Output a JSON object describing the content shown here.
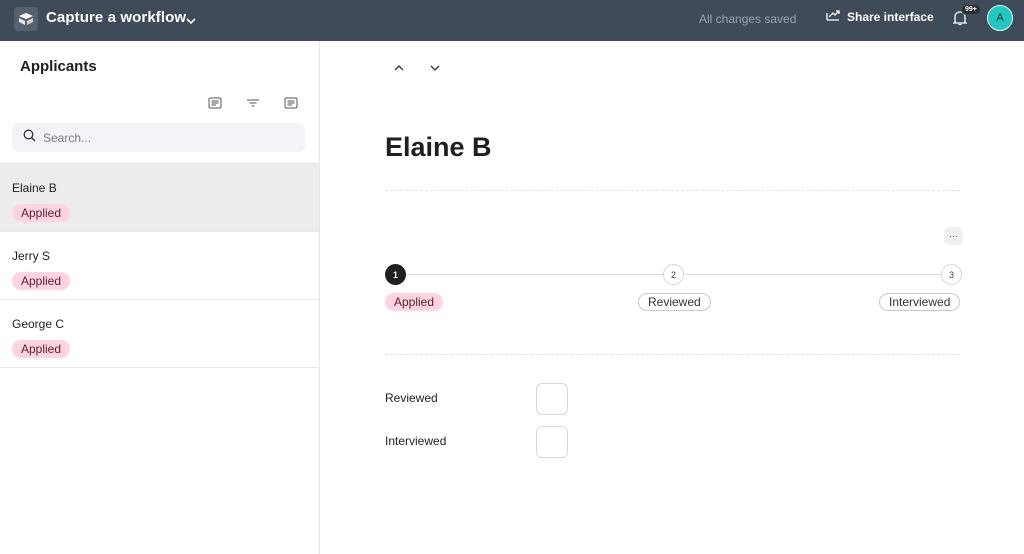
{
  "header": {
    "app_title": "Capture a workflow",
    "save_status": "All changes saved",
    "share_label": "Share interface",
    "notification_count": "99+",
    "avatar_initial": "A"
  },
  "sidebar": {
    "title": "Applicants",
    "search_placeholder": "Search...",
    "records": [
      {
        "name": "Elaine B",
        "status": "Applied",
        "selected": true
      },
      {
        "name": "Jerry S",
        "status": "Applied",
        "selected": false
      },
      {
        "name": "George C",
        "status": "Applied",
        "selected": false
      }
    ]
  },
  "record": {
    "name": "Elaine B",
    "more_label": "···",
    "steps": [
      {
        "number": "1",
        "label": "Applied",
        "active": true
      },
      {
        "number": "2",
        "label": "Reviewed",
        "active": false
      },
      {
        "number": "3",
        "label": "Interviewed",
        "active": false
      }
    ],
    "fields": [
      {
        "label": "Reviewed",
        "checked": false
      },
      {
        "label": "Interviewed",
        "checked": false
      }
    ]
  },
  "colors": {
    "topbar": "#3f4b59",
    "applied_pill": "#ffd4e0",
    "avatar": "#20c9c0",
    "selected_row": "#ececec"
  }
}
